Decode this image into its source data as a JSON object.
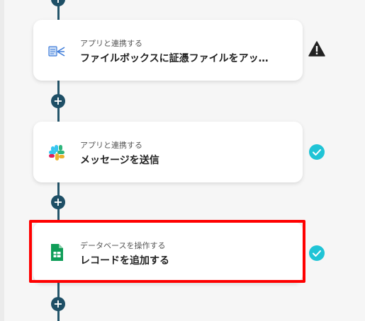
{
  "steps": [
    {
      "category": "アプリと連携する",
      "title": "ファイルボックスに証憑ファイルをアッ…",
      "icon": "file-box-icon",
      "status": "warning"
    },
    {
      "category": "アプリと連携する",
      "title": "メッセージを送信",
      "icon": "slack-icon",
      "status": "done"
    },
    {
      "category": "データベースを操作する",
      "title": "レコードを追加する",
      "icon": "google-sheets-icon",
      "status": "done",
      "highlighted": true
    }
  ],
  "add_step_label": "+",
  "colors": {
    "connector": "#25566b",
    "check": "#20c4d6",
    "highlight": "#ff0000",
    "warning": "#222222"
  }
}
